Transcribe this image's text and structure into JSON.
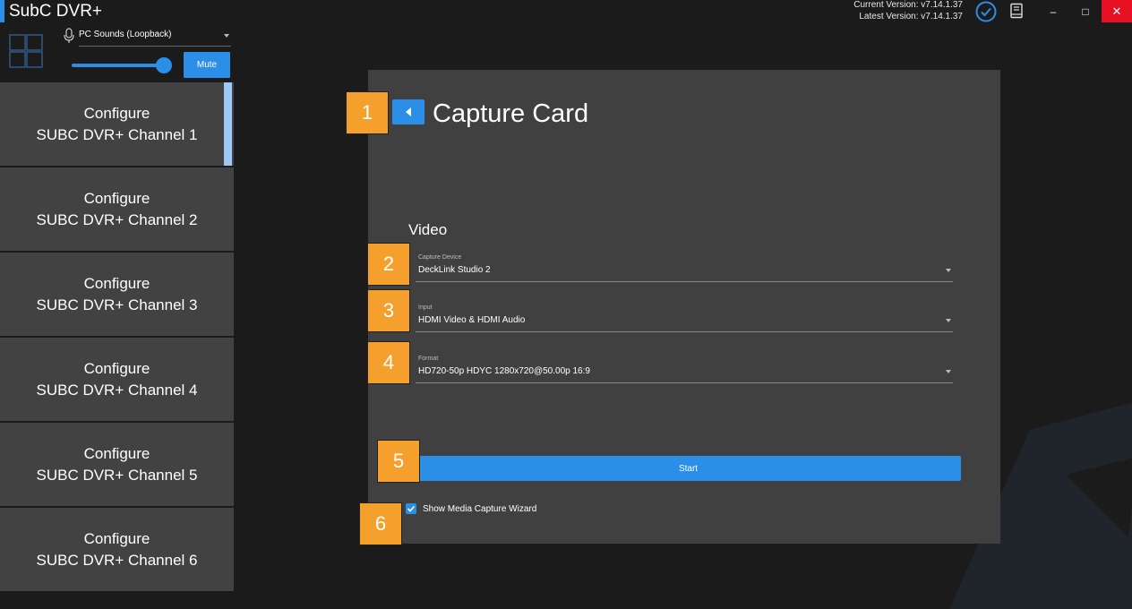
{
  "app": {
    "title": "SubC DVR+",
    "current_version": "Current Version: v7.14.1.37",
    "latest_version": "Latest Version: v7.14.1.37",
    "accent_color": "#2b8fe8",
    "close_color": "#e81123"
  },
  "window_controls": {
    "minimize": "–",
    "maximize": "□",
    "close": "✕"
  },
  "audio": {
    "source": "PC Sounds (Loopback)",
    "volume": 1.0,
    "mute_label": "Mute"
  },
  "channels": [
    {
      "line1": "Configure",
      "line2": "SUBC DVR+ Channel 1",
      "active": true
    },
    {
      "line1": "Configure",
      "line2": "SUBC DVR+ Channel 2",
      "active": false
    },
    {
      "line1": "Configure",
      "line2": "SUBC DVR+ Channel 3",
      "active": false
    },
    {
      "line1": "Configure",
      "line2": "SUBC DVR+ Channel 4",
      "active": false
    },
    {
      "line1": "Configure",
      "line2": "SUBC DVR+ Channel 5",
      "active": false
    },
    {
      "line1": "Configure",
      "line2": "SUBC DVR+ Channel 6",
      "active": false
    }
  ],
  "panel": {
    "title": "Capture Card",
    "section": "Video",
    "capture_device": {
      "label": "Capture Device",
      "value": "DeckLink Studio 2"
    },
    "input": {
      "label": "Input",
      "value": "HDMI Video & HDMI Audio"
    },
    "format": {
      "label": "Format",
      "value": "HD720-50p HDYC 1280x720@50.00p 16:9"
    },
    "start_label": "Start",
    "wizard_label": "Show Media Capture Wizard",
    "wizard_checked": true
  },
  "markers": [
    "1",
    "2",
    "3",
    "4",
    "5",
    "6"
  ]
}
